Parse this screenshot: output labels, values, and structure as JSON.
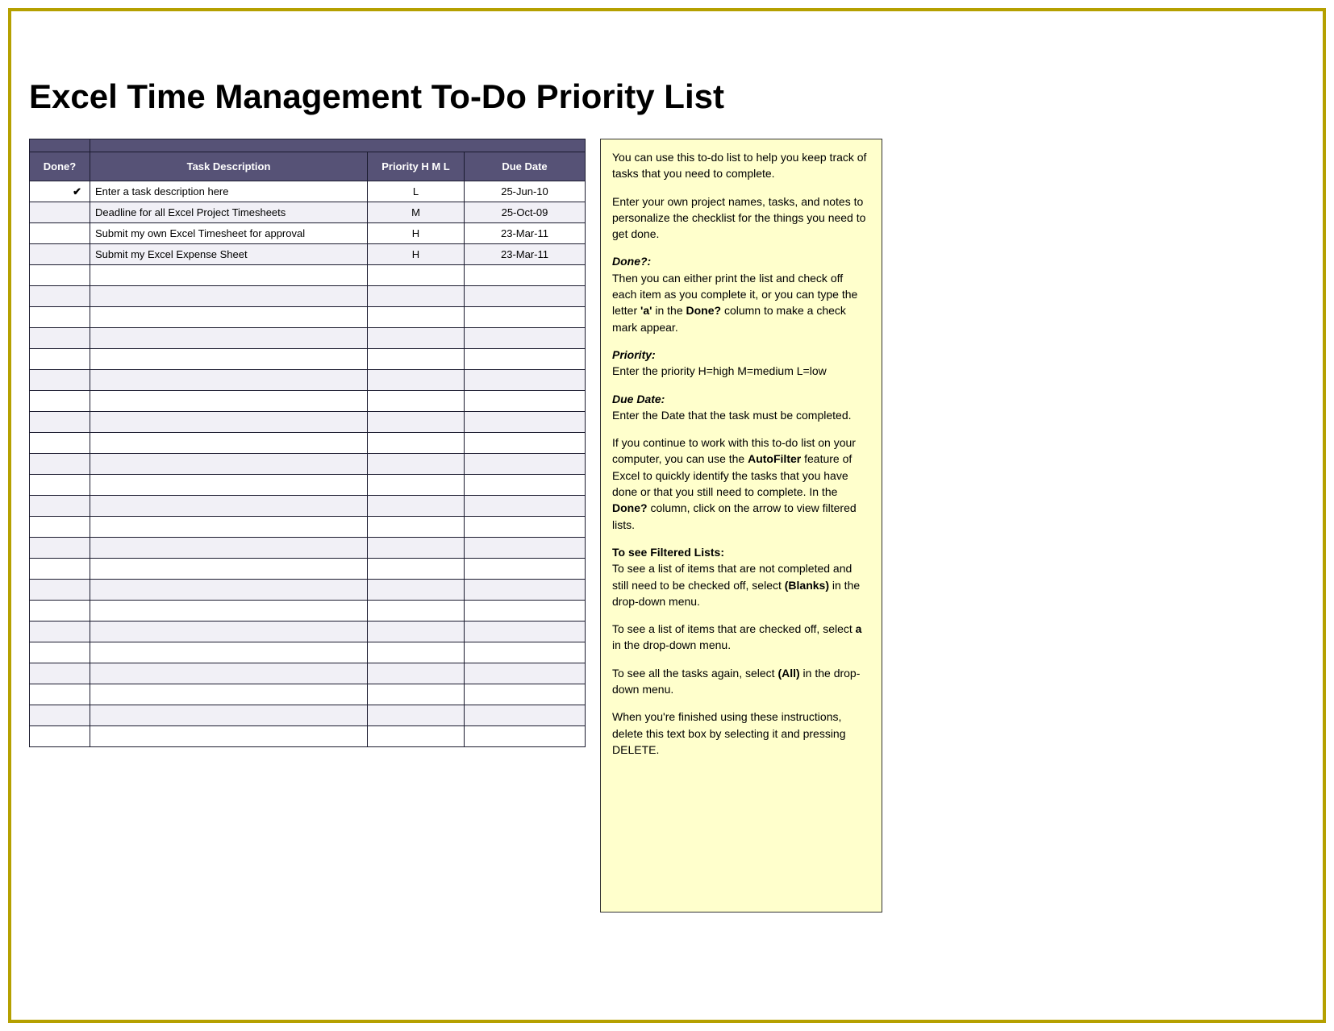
{
  "title": "Excel Time Management To-Do Priority List",
  "table": {
    "headers": {
      "done": "Done?",
      "task": "Task Description",
      "priority": "Priority H M L",
      "due": "Due Date"
    },
    "rows": [
      {
        "done": "✔",
        "task": "Enter a task description here",
        "priority": "L",
        "due": "25-Jun-10"
      },
      {
        "done": "",
        "task": "Deadline for all Excel Project Timesheets",
        "priority": "M",
        "due": "25-Oct-09"
      },
      {
        "done": "",
        "task": "Submit my own Excel Timesheet for approval",
        "priority": "H",
        "due": "23-Mar-11"
      },
      {
        "done": "",
        "task": "Submit my Excel Expense Sheet",
        "priority": "H",
        "due": "23-Mar-11"
      }
    ],
    "emptyRowCount": 23
  },
  "instructions": {
    "intro1": "You can use this to-do list to help you keep track of tasks that you need to complete.",
    "intro2": "Enter your own project names, tasks, and notes to personalize the checklist for the things you need to get done.",
    "doneLabel": "Done?:",
    "doneText1": "Then you can either print the list and check off each item as you complete it, or you can type the letter ",
    "doneLetterA": "'a'",
    "doneText2": " in the ",
    "doneColBold": "Done?",
    "doneText3": " column to make a check mark appear.",
    "priorityLabel": "Priority:",
    "priorityText": "Enter the priority  H=high M=medium L=low",
    "dueLabel": "Due Date:",
    "dueText": "Enter the Date that the task must be completed.",
    "autofilter1": "If you continue to work with this to-do list on your computer, you can use the ",
    "autofilterBold": "AutoFilter",
    "autofilter2": " feature of Excel to quickly identify the tasks that you have done or that you still need to complete. In the ",
    "autofilterDoneBold": "Done?",
    "autofilter3": " column, click on the arrow to view filtered lists.",
    "filteredHeading": "To see Filtered Lists:",
    "blanks1": "To see a list of items that are not completed and still need to be checked off, select ",
    "blanksBold": "(Blanks)",
    "blanks2": " in the drop-down menu.",
    "checkeda1": "To see a list of items that are checked off, select ",
    "checkedaBold": "a",
    "checkeda2": " in the drop-down menu.",
    "all1": "To see all the tasks again, select ",
    "allBold": "(All)",
    "all2": " in the drop-down menu.",
    "finish": "When you're finished using these instructions, delete this text box by selecting it and pressing DELETE."
  }
}
